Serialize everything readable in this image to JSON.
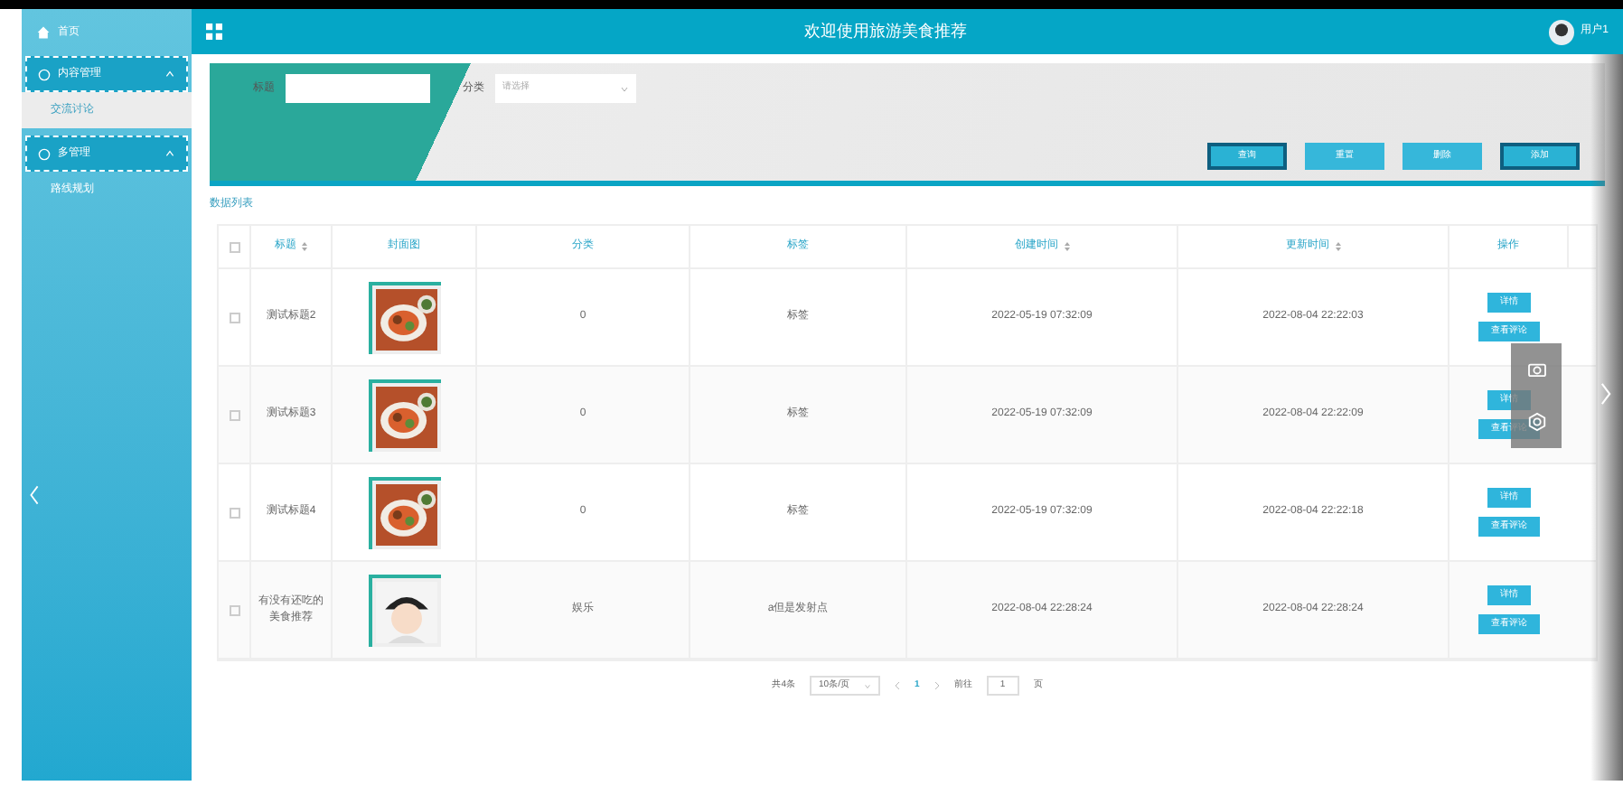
{
  "sidebar": {
    "home": "首页",
    "groups": [
      {
        "label": "内容管理",
        "expanded": true,
        "children": [
          {
            "label": "交流讨论",
            "selected": true
          }
        ]
      },
      {
        "label": "多管理",
        "expanded": true,
        "children": [
          {
            "label": "路线规划",
            "selected": false
          }
        ]
      }
    ]
  },
  "header": {
    "title": "欢迎使用旅游美食推荐",
    "user": "用户1"
  },
  "search": {
    "fields": [
      {
        "kind": "input",
        "label": "标题"
      },
      {
        "kind": "select",
        "label": "分类",
        "placeholder": "请选择"
      }
    ],
    "buttons": [
      {
        "label": "查询",
        "kind": "outline"
      },
      {
        "label": "重置",
        "kind": "filled"
      },
      {
        "label": "删除",
        "kind": "filled"
      },
      {
        "label": "添加",
        "kind": "outline"
      }
    ]
  },
  "list_title": "数据列表",
  "table": {
    "all_checked": false,
    "columns": [
      {
        "label": "标题",
        "sortable": true
      },
      {
        "label": "封面图",
        "sortable": false
      },
      {
        "label": "分类",
        "sortable": false
      },
      {
        "label": "标签",
        "sortable": false
      },
      {
        "label": "创建时间",
        "sortable": true
      },
      {
        "label": "更新时间",
        "sortable": true
      },
      {
        "label": "操作",
        "sortable": false
      }
    ],
    "rows": [
      {
        "checked": false,
        "title": "测试标题2",
        "category": "0",
        "tag": "标签",
        "created": "2022-05-19 07:32:09",
        "updated": "2022-08-04 22:22:03",
        "actions": [
          "详情",
          "查看评论"
        ]
      },
      {
        "checked": false,
        "title": "测试标题3",
        "category": "0",
        "tag": "标签",
        "created": "2022-05-19 07:32:09",
        "updated": "2022-08-04 22:22:09",
        "actions": [
          "详情",
          "查看评论"
        ]
      },
      {
        "checked": false,
        "title": "测试标题4",
        "category": "0",
        "tag": "标签",
        "created": "2022-05-19 07:32:09",
        "updated": "2022-08-04 22:22:18",
        "actions": [
          "详情",
          "查看评论"
        ]
      },
      {
        "checked": false,
        "title": "有没有还吃的美食推荐",
        "category": "娱乐",
        "tag": "a但是发射点",
        "created": "2022-08-04 22:28:24",
        "updated": "2022-08-04 22:28:24",
        "actions": [
          "详情",
          "查看评论"
        ]
      }
    ]
  },
  "pagination": {
    "total": "共4条",
    "page_size": "10条/页",
    "pages": [
      {
        "label": "1",
        "selected": true
      }
    ],
    "goto_label": "前往",
    "goto_value": "1",
    "page_suffix": "页"
  }
}
